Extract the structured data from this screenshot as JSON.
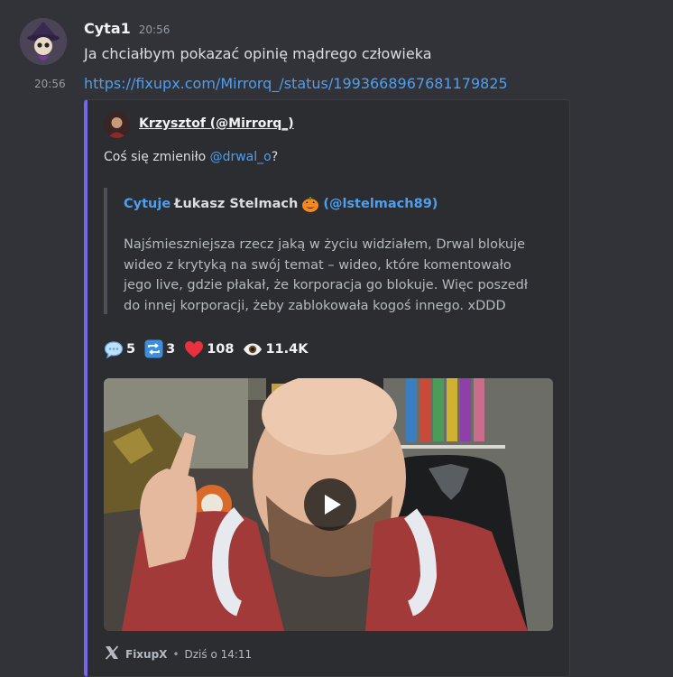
{
  "message": {
    "author": "Cyta1",
    "timestamp": "20:56",
    "text": "Ja chciałbym pokazać opinię mądrego człowieka",
    "hover_timestamp": "20:56",
    "link": "https://fixupx.com/Mirrorq_/status/1993668967681179825"
  },
  "embed": {
    "accent_color": "#7667e9",
    "author": "Krzysztof (@Mirrorq_)",
    "text_before_mention": "Coś się zmieniło ",
    "mention": "@drwal_o",
    "text_after_mention": "?",
    "quote": {
      "prefix": "Cytuje",
      "name": "Łukasz Stelmach",
      "handle": "(@lstelmach89)",
      "lines": [
        "Najśmieszniejsza rzecz jaką w życiu widziałem, Drwal blokuje",
        "wideo z krytyką na swój temat – wideo, które komentowało",
        "jego live, gdzie płakał, że korporacja go blokuje. Więc poszedł",
        "do innej korporacji, żeby zablokowała kogoś innego. xDDD"
      ]
    },
    "stats": {
      "replies": "5",
      "retweets": "3",
      "likes": "108",
      "views": "11.4K"
    },
    "footer": {
      "provider": "FixupX",
      "separator": "•",
      "time": "Dziś o 14:11"
    }
  }
}
